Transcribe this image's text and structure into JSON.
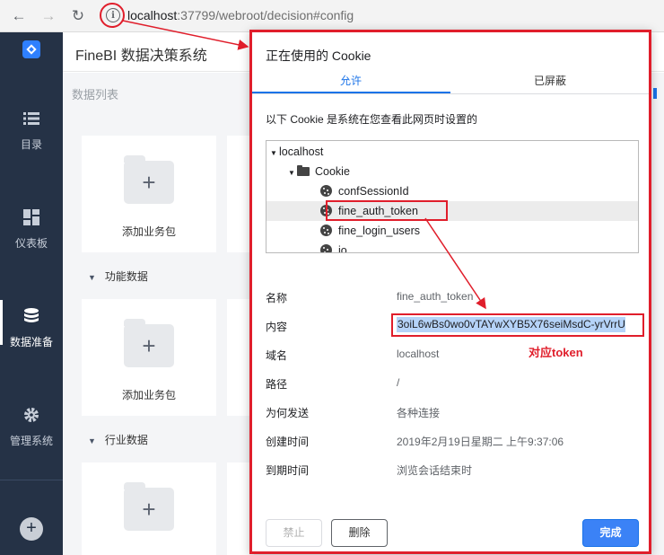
{
  "browser": {
    "url_host": "localhost",
    "url_rest": ":37799/webroot/decision#config",
    "icons": [
      "back-icon",
      "forward-icon",
      "reload-icon",
      "info-icon"
    ]
  },
  "app": {
    "title": "FineBI 数据决策系统"
  },
  "sidebar": {
    "items": [
      {
        "label": "目录",
        "icon": "list-icon"
      },
      {
        "label": "仪表板",
        "icon": "dashboard-icon"
      },
      {
        "label": "数据准备",
        "icon": "database-icon",
        "active": true
      },
      {
        "label": "管理系统",
        "icon": "gear-icon"
      }
    ],
    "add": "+"
  },
  "main": {
    "list_title": "数据列表",
    "card_label": "添加业务包",
    "sections": [
      "功能数据",
      "行业数据"
    ]
  },
  "dialog": {
    "title": "正在使用的 Cookie",
    "tabs": [
      "允许",
      "已屏蔽"
    ],
    "description": "以下 Cookie 是系统在您查看此网页时设置的",
    "tree": {
      "host": "localhost",
      "folder": "Cookie",
      "cookies": [
        "confSessionId",
        "fine_auth_token",
        "fine_login_users",
        "io"
      ]
    },
    "details": [
      {
        "label": "名称",
        "value": "fine_auth_token"
      },
      {
        "label": "内容",
        "value": "3oiL6wBs0wo0vTAYwXYB5X76seiMsdC-yrVrrU"
      },
      {
        "label": "域名",
        "value": "localhost"
      },
      {
        "label": "路径",
        "value": "/"
      },
      {
        "label": "为何发送",
        "value": "各种连接"
      },
      {
        "label": "创建时间",
        "value": "2019年2月19日星期二 上午9:37:06"
      },
      {
        "label": "到期时间",
        "value": "浏览会话结束时"
      }
    ],
    "annotation": "对应token",
    "buttons": {
      "block": "禁止",
      "delete": "删除",
      "done": "完成"
    }
  },
  "colors": {
    "accent": "#1a73e8",
    "annotation_red": "#e01e2b",
    "sidebar": "#253246",
    "done_button": "#3b82f6"
  }
}
